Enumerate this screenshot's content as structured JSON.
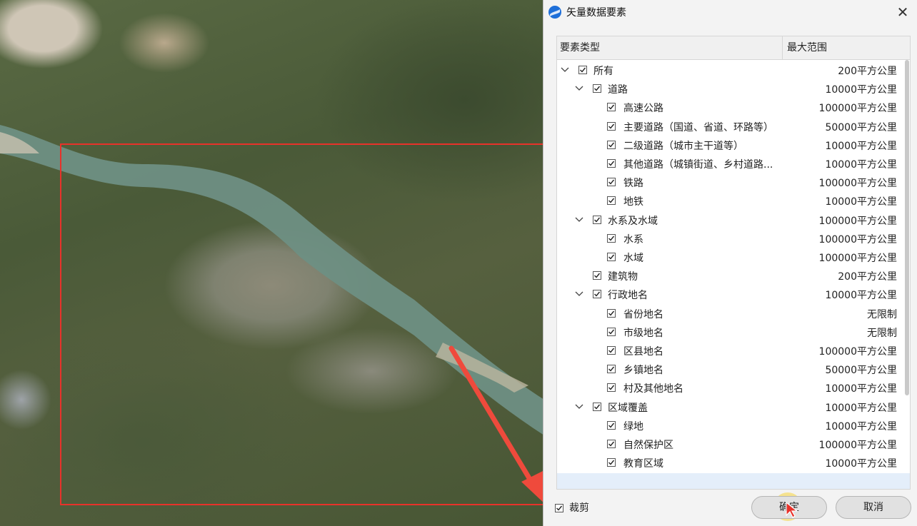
{
  "dialog": {
    "title": "矢量数据要素",
    "columns": {
      "type": "要素类型",
      "range": "最大范围"
    },
    "rows": [
      {
        "level": 0,
        "expanded": true,
        "checked": true,
        "label": "所有",
        "range": "200平方公里"
      },
      {
        "level": 1,
        "expanded": true,
        "checked": true,
        "label": "道路",
        "range": "10000平方公里"
      },
      {
        "level": 2,
        "checked": true,
        "label": "高速公路",
        "range": "100000平方公里"
      },
      {
        "level": 2,
        "checked": true,
        "label": "主要道路（国道、省道、环路等）",
        "range": "50000平方公里"
      },
      {
        "level": 2,
        "checked": true,
        "label": "二级道路（城市主干道等）",
        "range": "10000平方公里"
      },
      {
        "level": 2,
        "checked": true,
        "label": "其他道路（城镇街道、乡村道路...",
        "range": "10000平方公里"
      },
      {
        "level": 2,
        "checked": true,
        "label": "铁路",
        "range": "100000平方公里"
      },
      {
        "level": 2,
        "checked": true,
        "label": "地铁",
        "range": "10000平方公里"
      },
      {
        "level": 1,
        "expanded": true,
        "checked": true,
        "label": "水系及水域",
        "range": "100000平方公里"
      },
      {
        "level": 2,
        "checked": true,
        "label": "水系",
        "range": "100000平方公里"
      },
      {
        "level": 2,
        "checked": true,
        "label": "水域",
        "range": "100000平方公里"
      },
      {
        "level": 1,
        "checked": true,
        "label": "建筑物",
        "range": "200平方公里"
      },
      {
        "level": 1,
        "expanded": true,
        "checked": true,
        "label": "行政地名",
        "range": "10000平方公里"
      },
      {
        "level": 2,
        "checked": true,
        "label": "省份地名",
        "range": "无限制"
      },
      {
        "level": 2,
        "checked": true,
        "label": "市级地名",
        "range": "无限制"
      },
      {
        "level": 2,
        "checked": true,
        "label": "区县地名",
        "range": "100000平方公里"
      },
      {
        "level": 2,
        "checked": true,
        "label": "乡镇地名",
        "range": "50000平方公里"
      },
      {
        "level": 2,
        "checked": true,
        "label": "村及其他地名",
        "range": "10000平方公里"
      },
      {
        "level": 1,
        "expanded": true,
        "checked": true,
        "label": "区域覆盖",
        "range": "10000平方公里"
      },
      {
        "level": 2,
        "checked": true,
        "label": "绿地",
        "range": "10000平方公里"
      },
      {
        "level": 2,
        "checked": true,
        "label": "自然保护区",
        "range": "100000平方公里"
      },
      {
        "level": 2,
        "checked": true,
        "label": "教育区域",
        "range": "10000平方公里"
      }
    ],
    "crop": {
      "label": "裁剪",
      "checked": true
    },
    "ok_label": "确定",
    "cancel_label": "取消"
  },
  "colors": {
    "clip_rect": "#e8322a",
    "arrow": "#ef4a3c",
    "selected_row": "#e4eefa"
  }
}
